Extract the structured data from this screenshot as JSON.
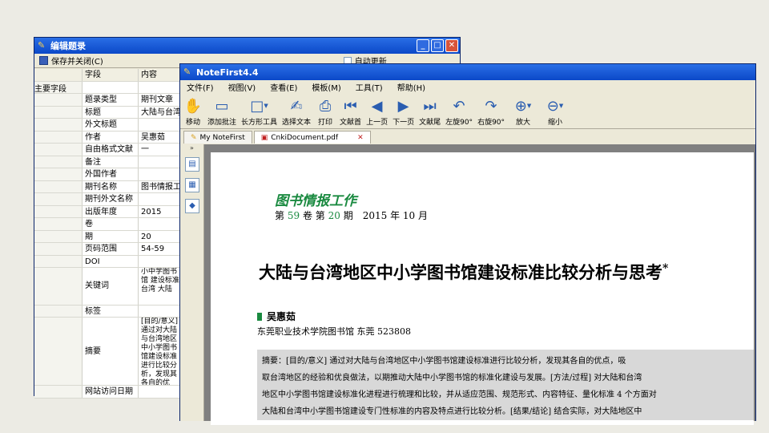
{
  "win1": {
    "title": "编辑题录",
    "save_label": "保存并关闭(C)",
    "check_label": "自动更新",
    "col_field": "字段",
    "col_content": "内容",
    "rows": [
      {
        "group": "主要字段",
        "field": "",
        "value": ""
      },
      {
        "group": "",
        "field": "题录类型",
        "value": "期刊文章"
      },
      {
        "group": "",
        "field": "标题",
        "value": "大陆与台湾地"
      },
      {
        "group": "",
        "field": "外文标题",
        "value": ""
      },
      {
        "group": "",
        "field": "作者",
        "value": "吴惠茹"
      },
      {
        "group": "",
        "field": "自由格式文献",
        "value": "一"
      },
      {
        "group": "",
        "field": "备注",
        "value": ""
      },
      {
        "group": "",
        "field": "外国作者",
        "value": ""
      },
      {
        "group": "",
        "field": "期刊名称",
        "value": "图书情报工作"
      },
      {
        "group": "",
        "field": "期刊外文名称",
        "value": ""
      },
      {
        "group": "",
        "field": "出版年度",
        "value": "2015"
      },
      {
        "group": "",
        "field": "卷",
        "value": ""
      },
      {
        "group": "",
        "field": "期",
        "value": "20"
      },
      {
        "group": "",
        "field": "页码范围",
        "value": "54-59"
      },
      {
        "group": "",
        "field": "DOI",
        "value": ""
      },
      {
        "group": "",
        "field": "关键词",
        "value": "小中学图书馆 建设标准 台湾 大陆"
      },
      {
        "group": "",
        "field": "标签",
        "value": ""
      },
      {
        "group": "",
        "field": "摘要",
        "value": "[目的/意义]通过对大陆与台湾地区中小学图书馆建设标准进行比较分析，发现其各自的优点，吸取台湾地区的经验和优良做法，设计更专业"
      },
      {
        "group": "",
        "field": "网站访问日期",
        "value": ""
      }
    ]
  },
  "win2": {
    "title": "NoteFirst4.4",
    "menu": [
      "文件(F)",
      "视图(V)",
      "查看(E)",
      "模板(M)",
      "工具(T)",
      "帮助(H)"
    ],
    "tools": [
      {
        "icon": "hand-icon",
        "label": "移动"
      },
      {
        "icon": "add-note-icon",
        "label": "添加批注"
      },
      {
        "icon": "rect-icon",
        "label": "长方形工具"
      },
      {
        "icon": "select-text-icon",
        "label": "选择文本"
      },
      {
        "icon": "print-icon",
        "label": "打印"
      },
      {
        "icon": "first-page-icon",
        "label": "文献首"
      },
      {
        "icon": "prev-page-icon",
        "label": "上一页"
      },
      {
        "icon": "next-page-icon",
        "label": "下一页"
      },
      {
        "icon": "last-page-icon",
        "label": "文献尾"
      },
      {
        "icon": "rotate-left-icon",
        "label": "左旋90°"
      },
      {
        "icon": "rotate-right-icon",
        "label": "右旋90°"
      },
      {
        "icon": "zoom-in-icon",
        "label": "放大"
      },
      {
        "icon": "zoom-out-icon",
        "label": "缩小"
      }
    ],
    "tabs": [
      {
        "label": "My NoteFirst"
      },
      {
        "label": "CnkiDocument.pdf"
      }
    ],
    "document": {
      "journal": "图书情报工作",
      "issue_pre": "第",
      "volume": "59",
      "issue_mid": "卷 第",
      "number": "20",
      "issue_post": "期　2015 年 10 月",
      "title": "大陆与台湾地区中小学图书馆建设标准比较分析与思考",
      "title_mark": "*",
      "author": "吴惠茹",
      "affiliation": "东莞职业技术学院图书馆 东莞 523808",
      "abstract_lines": [
        "摘要：[目的/意义] 通过对大陆与台湾地区中小学图书馆建设标准进行比较分析，发现其各自的优点，吸",
        "取台湾地区的经验和优良做法，以期推动大陆中小学图书馆的标准化建设与发展。[方法/过程] 对大陆和台湾",
        "地区中小学图书馆建设标准化进程进行梳理和比较，并从适应范围、规范形式、内容特征、量化标准 4 个方面对",
        "大陆和台湾中小学图书馆建设专门性标准的内容及特点进行比较分析。[结果/结论] 结合实际，对大陆地区中"
      ]
    }
  }
}
